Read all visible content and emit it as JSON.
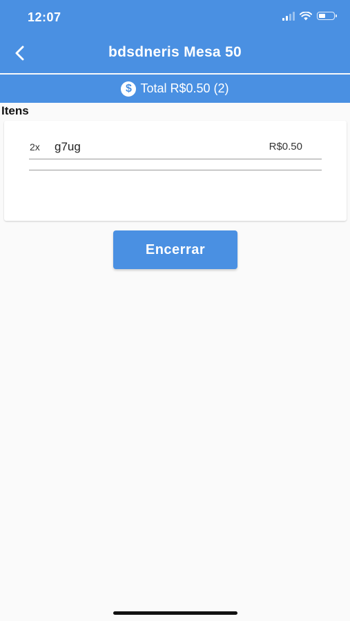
{
  "status_bar": {
    "time": "12:07",
    "icons": [
      "cellular-signal-icon",
      "wifi-icon",
      "battery-icon"
    ]
  },
  "header": {
    "title": "bdsdneris Mesa 50",
    "back_icon": "chevron-left-icon"
  },
  "total_bar": {
    "icon": "dollar-circle-icon",
    "label": "Total R$0.50 (2)"
  },
  "items_section": {
    "label": "Itens",
    "items": [
      {
        "qty": "2x",
        "name": "g7ug",
        "price": "R$0.50"
      }
    ]
  },
  "actions": {
    "close_label": "Encerrar"
  },
  "colors": {
    "primary": "#4a90e2",
    "background": "#fafafa",
    "card": "#ffffff"
  }
}
